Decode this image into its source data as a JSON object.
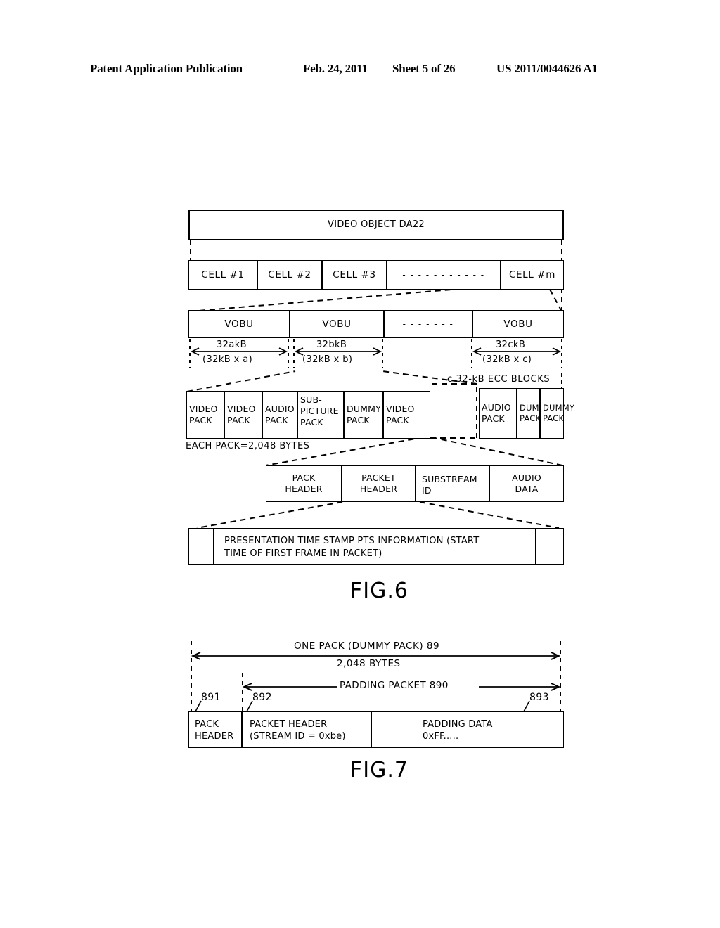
{
  "header": {
    "left": "Patent Application Publication",
    "date": "Feb. 24, 2011",
    "sheet": "Sheet 5 of 26",
    "patent_number": "US 2011/0044626 A1"
  },
  "fig6": {
    "caption": "FIG.6",
    "video_object": "VIDEO OBJECT DA22",
    "cells": [
      {
        "label": "CELL #1"
      },
      {
        "label": "CELL #2"
      },
      {
        "label": "CELL #3"
      },
      {
        "label": "- - - - - - - - - - -"
      },
      {
        "label": "CELL #m"
      }
    ],
    "vobus": [
      {
        "label": "VOBU"
      },
      {
        "label": "VOBU"
      },
      {
        "label": "- - - - - - -"
      },
      {
        "label": "VOBU"
      }
    ],
    "vobu_sizes": [
      {
        "size": "32akB",
        "formula": "(32kB x a)"
      },
      {
        "size": "32bkB",
        "formula": "(32kB x b)"
      },
      {
        "size": "32ckB",
        "formula": "(32kB x c)"
      }
    ],
    "ecc_label": "c 32-kB ECC BLOCKS",
    "packs_left": [
      {
        "line1": "VIDEO",
        "line2": "PACK",
        "line3": ""
      },
      {
        "line1": "VIDEO",
        "line2": "PACK",
        "line3": ""
      },
      {
        "line1": "AUDIO",
        "line2": "PACK",
        "line3": ""
      },
      {
        "line1": "SUB-",
        "line2": "PICTURE",
        "line3": "PACK"
      },
      {
        "line1": "DUMMY",
        "line2": "PACK",
        "line3": ""
      },
      {
        "line1": "VIDEO",
        "line2": "PACK",
        "line3": ""
      }
    ],
    "packs_right": [
      {
        "line1": "AUDIO",
        "line2": "PACK",
        "line3": ""
      },
      {
        "line1": "DUMMY",
        "line2": "PACK",
        "line3": ""
      },
      {
        "line1": "DUMMY",
        "line2": "PACK",
        "line3": ""
      }
    ],
    "each_pack_note": "EACH PACK=2,048 BYTES",
    "pack_fields": [
      {
        "line1": "PACK",
        "line2": "HEADER"
      },
      {
        "line1": "PACKET",
        "line2": "HEADER"
      },
      {
        "line1": "SUBSTREAM",
        "line2": "ID"
      },
      {
        "line1": "AUDIO",
        "line2": "DATA"
      }
    ],
    "pts_left_ellipsis": "- - -",
    "pts_right_ellipsis": "- - -",
    "pts_line1": "PRESENTATION TIME STAMP PTS INFORMATION (START",
    "pts_line2": "TIME OF FIRST FRAME IN PACKET)"
  },
  "fig7": {
    "caption": "FIG.7",
    "one_pack_label": "ONE PACK (DUMMY PACK) 89",
    "one_pack_bytes": "2,048 BYTES",
    "padding_packet_label": "PADDING PACKET 890",
    "ref_891": "891",
    "ref_892": "892",
    "ref_893": "893",
    "boxes": [
      {
        "line1": "PACK",
        "line2": "HEADER"
      },
      {
        "line1": "PACKET HEADER",
        "line2": "(STREAM ID = 0xbe)"
      },
      {
        "line1": "PADDING DATA",
        "line2": "0xFF....."
      }
    ]
  },
  "colors": {
    "ink": "#000000",
    "paper": "#ffffff"
  }
}
